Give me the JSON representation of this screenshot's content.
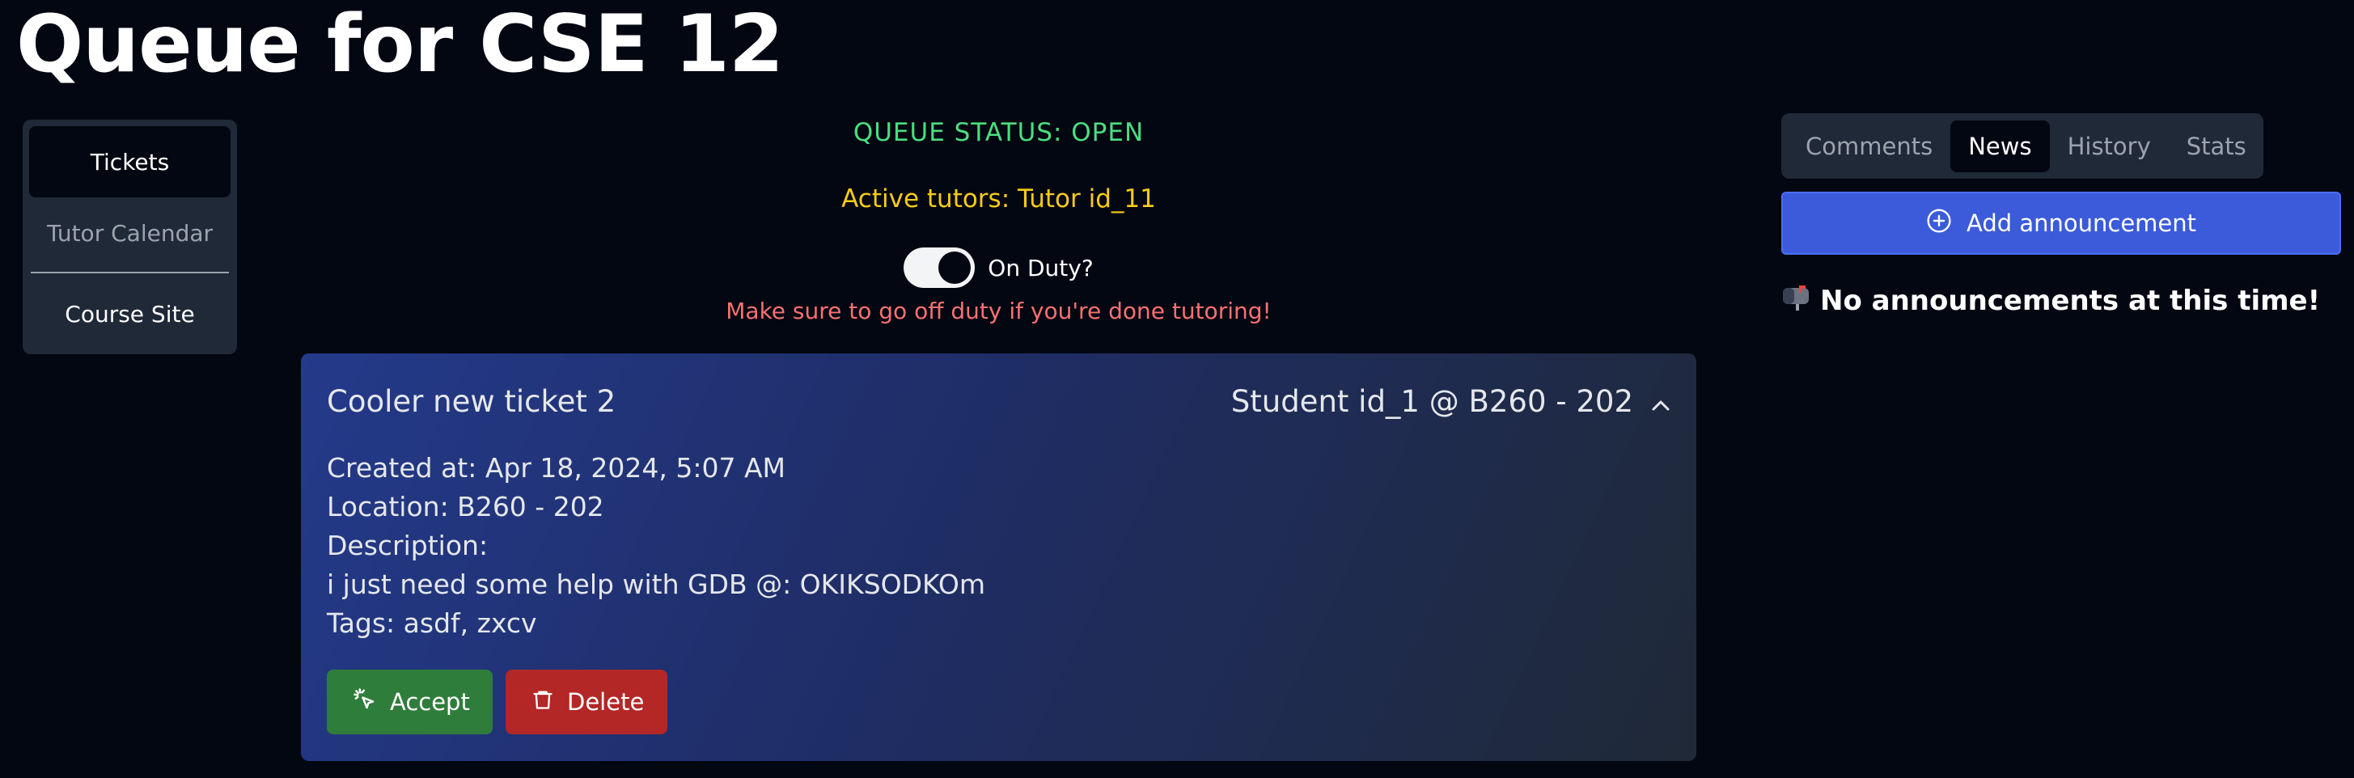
{
  "page": {
    "title": "Queue for CSE 12"
  },
  "sidebar": {
    "items": [
      {
        "label": "Tickets"
      },
      {
        "label": "Tutor Calendar"
      },
      {
        "label": "Course Site"
      }
    ]
  },
  "status": {
    "queue": "QUEUE STATUS: OPEN",
    "active_tutors": "Active tutors: Tutor id_11",
    "duty_label": "On Duty?",
    "duty_on": true,
    "warning": "Make sure to go off duty if you're done tutoring!"
  },
  "ticket": {
    "title": "Cooler new ticket 2",
    "owner": "Student id_1 @ B260 - 202",
    "created": "Created at: Apr 18, 2024, 5:07 AM",
    "location": "Location: B260 - 202",
    "description_label": "Description:",
    "description": "i just need some help with GDB @: OKIKSODKOm",
    "tags": "Tags: asdf, zxcv",
    "accept_label": "Accept",
    "delete_label": "Delete"
  },
  "panel": {
    "tabs": [
      {
        "label": "Comments"
      },
      {
        "label": "News"
      },
      {
        "label": "History"
      },
      {
        "label": "Stats"
      }
    ],
    "active_tab": "News",
    "add_label": "Add announcement",
    "empty_message": "No announcements at this time!",
    "empty_icon": "mailbox-icon"
  },
  "colors": {
    "open": "#4ade80",
    "tutors": "#facc15",
    "warning": "#f87171",
    "accept": "#2f7d3a",
    "delete": "#b42727",
    "primary": "#3b5bdb"
  }
}
